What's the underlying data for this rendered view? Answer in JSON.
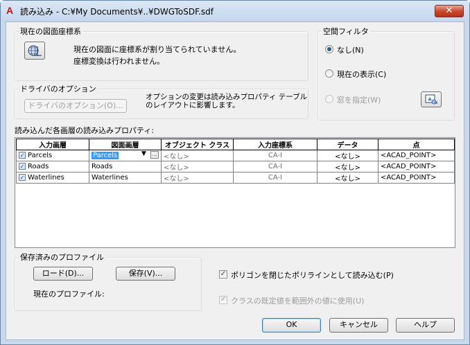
{
  "window": {
    "title": "読み込み - C:¥My Documents¥..¥DWGToSDF.sdf",
    "app_icon": "A",
    "close_label": "✕"
  },
  "coord_group": {
    "legend": "現在の図面座標系",
    "icon": "globe-icon",
    "line1": "現在の図面に座標系が割り当てられていません。",
    "line2": "座標変換は行われません。"
  },
  "driver_group": {
    "legend": "ドライバのオプション",
    "button": "ドライバのオプション(O)...",
    "note": "オプションの変更は読み込みプロパティ テーブルのレイアウトに影響します。"
  },
  "spatial_filter": {
    "legend": "空間フィルタ",
    "options": [
      {
        "label": "なし(N)",
        "checked": true,
        "enabled": true
      },
      {
        "label": "現在の表示(C)",
        "checked": false,
        "enabled": true
      },
      {
        "label": "窓を指定(W)",
        "checked": false,
        "enabled": false
      }
    ],
    "window_pick_icon": "window-select-icon"
  },
  "layers_table": {
    "label": "読み込んだ各画層の読み込みプロパティ:",
    "columns": [
      "入力画層",
      "図面画層",
      "オブジェクト クラス",
      "入力座標系",
      "データ",
      "点"
    ],
    "rows": [
      {
        "checked": true,
        "input_layer": "Parcels",
        "drawing_layer": "Parcels",
        "object_class": "<なし>",
        "coord_system": "CA-I",
        "data": "<なし>",
        "point": "<ACAD_POINT>",
        "editing": true
      },
      {
        "checked": true,
        "input_layer": "Roads",
        "drawing_layer": "Roads",
        "object_class": "<なし>",
        "coord_system": "CA-I",
        "data": "<なし>",
        "point": "<ACAD_POINT>",
        "editing": false
      },
      {
        "checked": true,
        "input_layer": "Waterlines",
        "drawing_layer": "Waterlines",
        "object_class": "<なし>",
        "coord_system": "CA-I",
        "data": "<なし>",
        "point": "<ACAD_POINT>",
        "editing": false
      }
    ]
  },
  "profile_group": {
    "legend": "保存済みのプロファイル",
    "load_button": "ロード(D)...",
    "save_button": "保存(V)...",
    "current_label": "現在のプロファイル:"
  },
  "options": {
    "polygon_label": "ポリゴンを閉じたポリラインとして読み込む(P)",
    "polygon_checked": true,
    "class_default_label": "クラスの既定値を範囲外の値に使用(U)",
    "class_default_checked": true,
    "class_default_enabled": false
  },
  "buttons": {
    "ok": "OK",
    "cancel": "キャンセル",
    "help": "ヘルプ"
  }
}
